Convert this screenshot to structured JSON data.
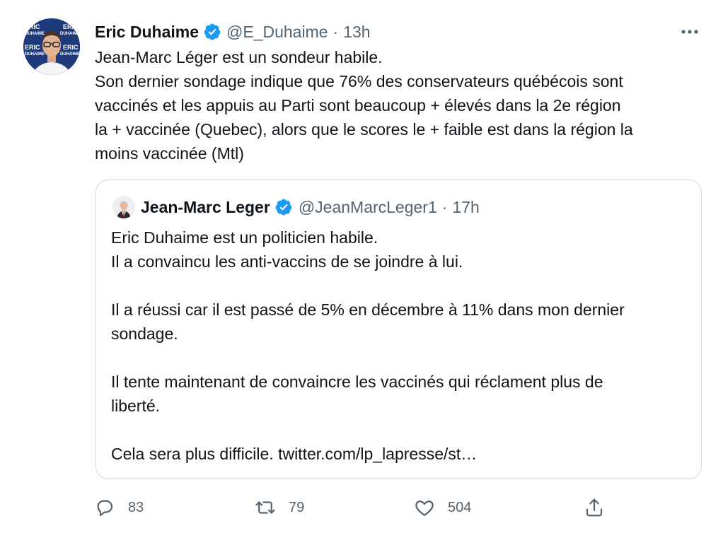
{
  "tweet": {
    "author_name": "Eric Duhaime",
    "handle": "@E_Duhaime",
    "separator": "·",
    "time": "13h",
    "avatar_text": [
      "ERIC",
      "DUHAIME"
    ],
    "lines": [
      "Jean-Marc Léger est un sondeur habile.",
      "Son dernier sondage indique que 76% des conservateurs québécois sont",
      "vaccinés et les appuis au Parti sont beaucoup + élevés dans la 2e région",
      "la + vaccinée (Quebec), alors que le scores le + faible est dans la région la",
      "moins vaccinée (Mtl)"
    ]
  },
  "quote": {
    "author_name": "Jean-Marc Leger",
    "handle": "@JeanMarcLeger1",
    "separator": "·",
    "time": "17h",
    "lines": [
      "Eric Duhaime est un politicien habile.",
      "Il a convaincu les anti-vaccins de se joindre à lui.",
      "",
      "Il a réussi car il est passé de 5% en décembre à 11% dans mon dernier",
      "sondage.",
      "",
      "Il tente maintenant de convaincre les vaccinés qui réclament plus de",
      "liberté.",
      "",
      "Cela sera plus difficile. twitter.com/lp_lapresse/st…"
    ]
  },
  "actions": {
    "reply_count": "83",
    "retweet_count": "79",
    "like_count": "504"
  },
  "colors": {
    "text": "#0f1419",
    "secondary": "#536471",
    "verified": "#1d9bf0",
    "border": "#cfd9de"
  },
  "icons": [
    "verified-badge-icon",
    "more-icon",
    "reply-icon",
    "retweet-icon",
    "like-icon",
    "share-icon"
  ]
}
